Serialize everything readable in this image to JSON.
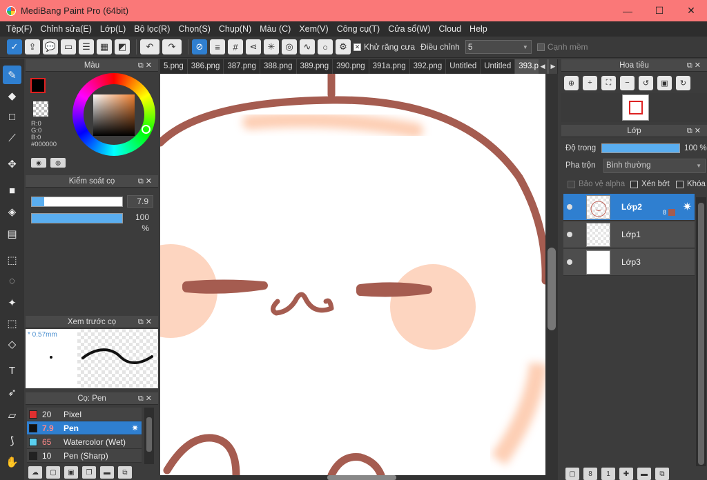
{
  "window": {
    "title": "MediBang Paint Pro (64bit)",
    "minimize": "—",
    "maximize": "☐",
    "close": "✕"
  },
  "menu": [
    "Tệp(F)",
    "Chỉnh sửa(E)",
    "Lớp(L)",
    "Bộ lọc(R)",
    "Chọn(S)",
    "Chụp(N)",
    "Màu (C)",
    "Xem(V)",
    "Công cụ(T)",
    "Cửa sổ(W)",
    "Cloud",
    "Help"
  ],
  "toolbar": {
    "antialias_label": "Khử răng cưa",
    "adjust_label": "Điều chỉnh",
    "adjust_value": "5",
    "soft_edge_label": "Cạnh mềm",
    "antialias_checked": "✕"
  },
  "tabs": [
    "5.png",
    "386.png",
    "387.png",
    "388.png",
    "389.png",
    "390.png",
    "391a.png",
    "392.png",
    "Untitled",
    "Untitled",
    "393.png"
  ],
  "color_panel": {
    "title": "Màu",
    "r": "R:0",
    "g": "G:0",
    "b": "B:0",
    "hex": "#000000"
  },
  "brush_control": {
    "title": "Kiểm soát cọ",
    "size_value": "7.9",
    "opacity_value": "100 %",
    "size_fraction": 0.14,
    "opacity_fraction": 1.0
  },
  "brush_preview": {
    "title": "Xem trước cọ",
    "size": "* 0.57mm"
  },
  "brush_list": {
    "title": "Cọ: Pen",
    "items": [
      {
        "size": "20",
        "name": "Pixel",
        "color": "#e03030"
      },
      {
        "size": "7.9",
        "name": "Pen",
        "color": "#111111"
      },
      {
        "size": "65",
        "name": "Watercolor (Wet)",
        "color": "#5ad0f0"
      },
      {
        "size": "10",
        "name": "Pen (Sharp)",
        "color": "#222222"
      }
    ]
  },
  "navigator": {
    "title": "Hoa tiêu"
  },
  "layers": {
    "title": "Lớp",
    "opacity_label": "Độ trong",
    "opacity_value": "100 %",
    "blend_label": "Pha trộn",
    "blend_value": "Bình thường",
    "protect_alpha": "Bảo vệ alpha",
    "clipping": "Xén bớt",
    "lock": "Khóa",
    "items": [
      {
        "name": "Lớp2",
        "badge": "8"
      },
      {
        "name": "Lớp1"
      },
      {
        "name": "Lớp3"
      }
    ]
  },
  "colors": {
    "title_bar": "#fa7878",
    "accent": "#2f7fd0",
    "stroke": "#a55c50",
    "blush": "#fdd5c0"
  }
}
